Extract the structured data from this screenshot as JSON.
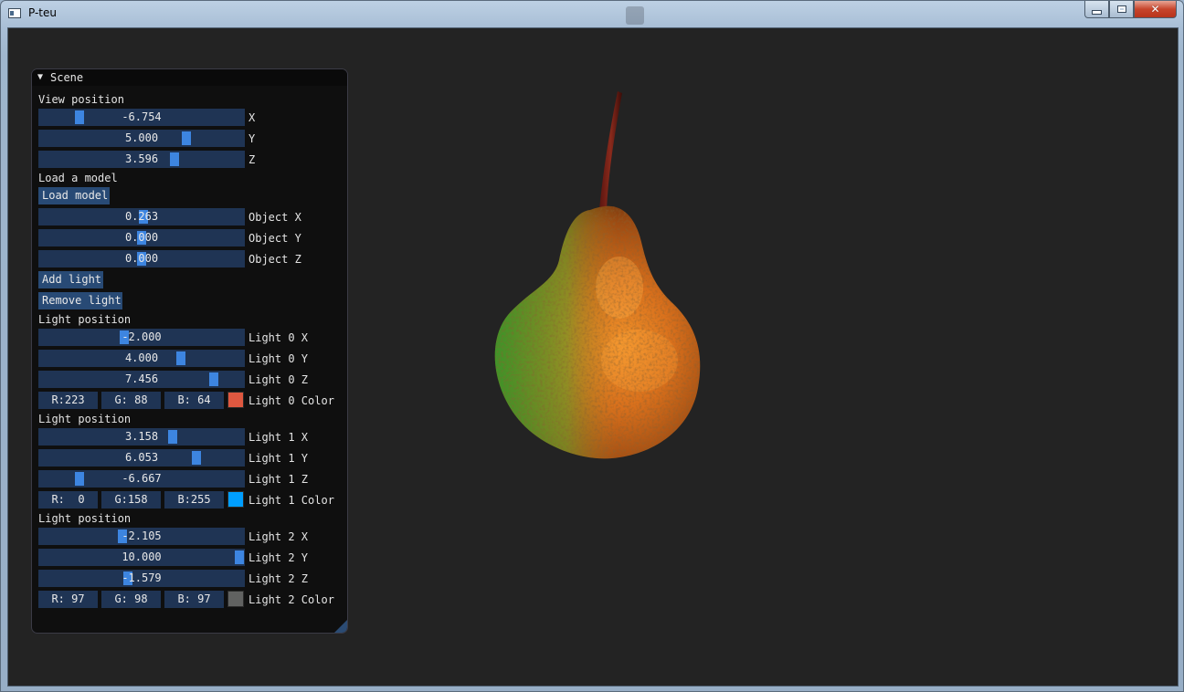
{
  "window": {
    "title": "P-teu",
    "close_glyph": "✕"
  },
  "panel": {
    "arrow": "▼",
    "title": "Scene",
    "view_label": "View position",
    "view": [
      {
        "value": "-6.754",
        "label": "X",
        "fraction": 0.18
      },
      {
        "value": "5.000",
        "label": "Y",
        "fraction": 0.73
      },
      {
        "value": "3.596",
        "label": "Z",
        "fraction": 0.67
      }
    ],
    "load_label": "Load a model",
    "load_button": "Load model",
    "object": [
      {
        "value": "0.263",
        "label": "Object X",
        "fraction": 0.51
      },
      {
        "value": "0.000",
        "label": "Object Y",
        "fraction": 0.5
      },
      {
        "value": "0.000",
        "label": "Object Z",
        "fraction": 0.5
      }
    ],
    "add_light_button": "Add light",
    "remove_light_button": "Remove light",
    "lights": [
      {
        "heading": "Light position",
        "x": {
          "value": "-2.000",
          "label": "Light 0 X",
          "fraction": 0.41
        },
        "y": {
          "value": "4.000",
          "label": "Light 0 Y",
          "fraction": 0.7
        },
        "z": {
          "value": "7.456",
          "label": "Light 0 Z",
          "fraction": 0.87
        },
        "r": "R:223",
        "g": "G: 88",
        "b": "B: 64",
        "color": "#df5840",
        "color_label": "Light 0 Color"
      },
      {
        "heading": "Light position",
        "x": {
          "value": "3.158",
          "label": "Light 1 X",
          "fraction": 0.66
        },
        "y": {
          "value": "6.053",
          "label": "Light 1 Y",
          "fraction": 0.78
        },
        "z": {
          "value": "-6.667",
          "label": "Light 1 Z",
          "fraction": 0.18
        },
        "r": "R:  0",
        "g": "G:158",
        "b": "B:255",
        "color": "#009eff",
        "color_label": "Light 1 Color"
      },
      {
        "heading": "Light position",
        "x": {
          "value": "-2.105",
          "label": "Light 2 X",
          "fraction": 0.4
        },
        "y": {
          "value": "10.000",
          "label": "Light 2 Y",
          "fraction": 1.0
        },
        "z": {
          "value": "-1.579",
          "label": "Light 2 Z",
          "fraction": 0.43
        },
        "r": "R: 97",
        "g": "G: 98",
        "b": "B: 97",
        "color": "#616261",
        "color_label": "Light 2 Color"
      }
    ]
  }
}
